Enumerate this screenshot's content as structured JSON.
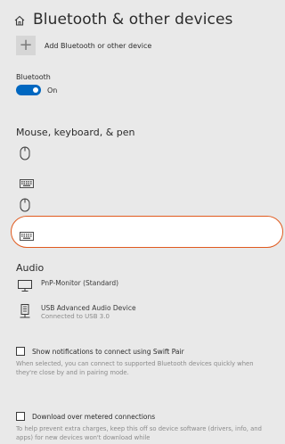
{
  "header": {
    "title": "Bluetooth & other devices",
    "icon": "home-icon"
  },
  "add_device": {
    "label": "Add Bluetooth or other device",
    "icon": "plus-icon"
  },
  "bluetooth": {
    "label": "Bluetooth",
    "toggle_state": "On",
    "toggle_on": true,
    "accent": "#0067c0"
  },
  "mouse_keyboard_pen": {
    "title": "Mouse, keyboard, & pen",
    "devices": [
      {
        "icon": "mouse-icon"
      },
      {
        "icon": "keyboard-icon"
      },
      {
        "icon": "mouse-icon"
      },
      {
        "icon": "keyboard-icon",
        "highlighted": true
      }
    ]
  },
  "highlight_color": "#e05a1e",
  "audio": {
    "title": "Audio",
    "devices": [
      {
        "icon": "monitor-icon",
        "name": "PnP-Monitor (Standard)",
        "status": ""
      },
      {
        "icon": "usb-audio-icon",
        "name": "USB Advanced Audio Device",
        "status": "Connected to USB 3.0"
      }
    ]
  },
  "swift_pair": {
    "label": "Show notifications to connect using Swift Pair",
    "checked": false,
    "description": "When selected, you can connect to supported Bluetooth devices quickly when they're close by and in pairing mode."
  },
  "metered": {
    "label": "Download over metered connections",
    "checked": false,
    "description": "To help prevent extra charges, keep this off so device software (drivers, info, and apps) for new devices won't download while"
  }
}
